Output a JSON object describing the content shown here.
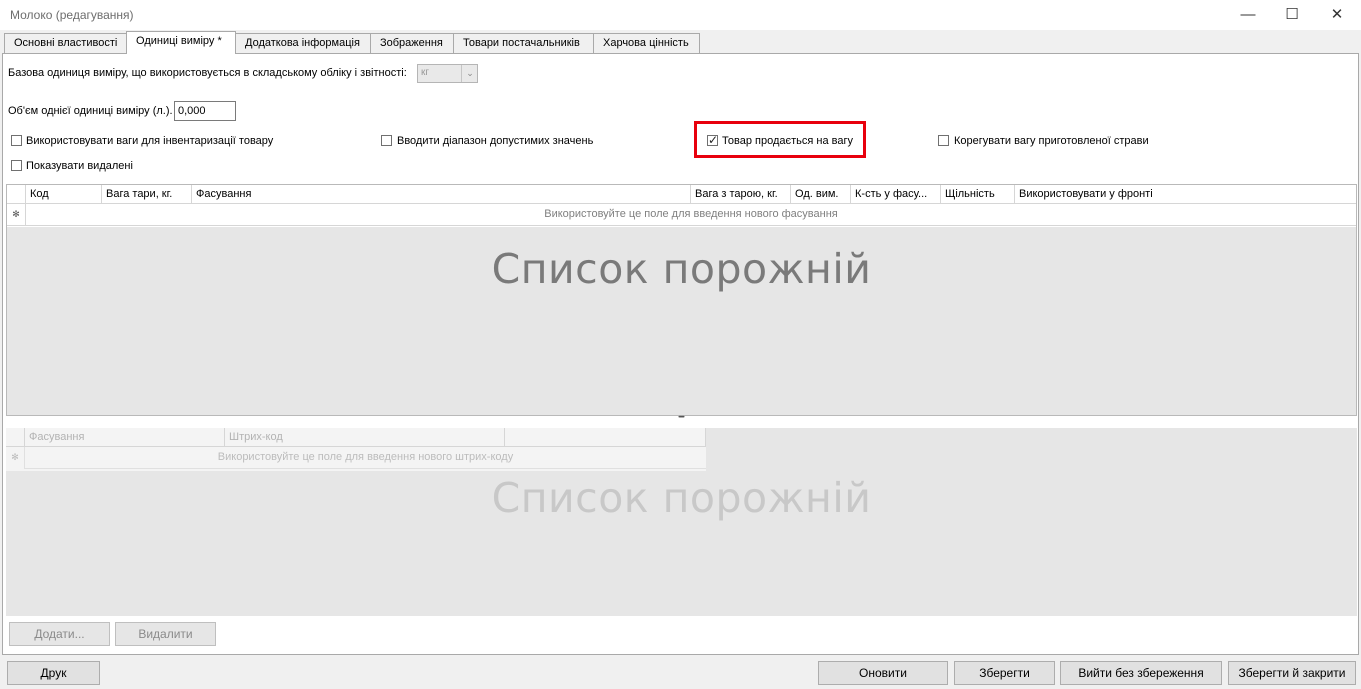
{
  "window": {
    "title": "Молоко (редагування)",
    "minimize": "—",
    "maximize": "☐",
    "close": "✕"
  },
  "tabs": [
    {
      "label": "Основні властивості"
    },
    {
      "label": "Одиниці виміру *"
    },
    {
      "label": "Додаткова інформація"
    },
    {
      "label": "Зображення"
    },
    {
      "label": "Товари постачальників"
    },
    {
      "label": "Харчова цінність"
    }
  ],
  "units": {
    "base_unit_label": "Базова одиниця виміру, що використовується в складському обліку і звітності:",
    "base_unit_value": "кг",
    "volume_label": "Об'єм однієї одиниці виміру (л.).",
    "volume_value": "0,000"
  },
  "checkboxes": {
    "use_scales": {
      "label": "Використовувати ваги для інвентаризації товару",
      "checked": false
    },
    "range": {
      "label": "Вводити діапазон допустимих значень",
      "checked": false
    },
    "sold_by_weight": {
      "label": "Товар продається на вагу",
      "checked": true
    },
    "adjust_weight": {
      "label": "Корегувати вагу приготовленої страви",
      "checked": false
    },
    "show_deleted": {
      "label": "Показувати видалені",
      "checked": false
    }
  },
  "highlight_color": "#e8000d",
  "packaging_table": {
    "columns": [
      "Код",
      "Вага тари, кг.",
      "Фасування",
      "Вага з тарою, кг.",
      "Од. вим.",
      "К-сть у фасу...",
      "Щільність",
      "Використовувати у фронті"
    ],
    "new_row_marker": "✻",
    "new_row_hint": "Використовуйте це поле для введення нового фасування",
    "empty_text": "Список порожній"
  },
  "splitter": "•••••",
  "barcode_table": {
    "columns": [
      "Фасування",
      "Штрих-код"
    ],
    "new_row_marker": "✻",
    "new_row_hint": "Використовуйте це поле для введення нового штрих-коду",
    "empty_text": "Список порожній"
  },
  "panel_buttons": {
    "add": "Додати...",
    "delete": "Видалити"
  },
  "footer_buttons": {
    "print": "Друк",
    "refresh": "Оновити",
    "save": "Зберегти",
    "exit_no_save": "Вийти без збереження",
    "save_close": "Зберегти й закрити"
  }
}
